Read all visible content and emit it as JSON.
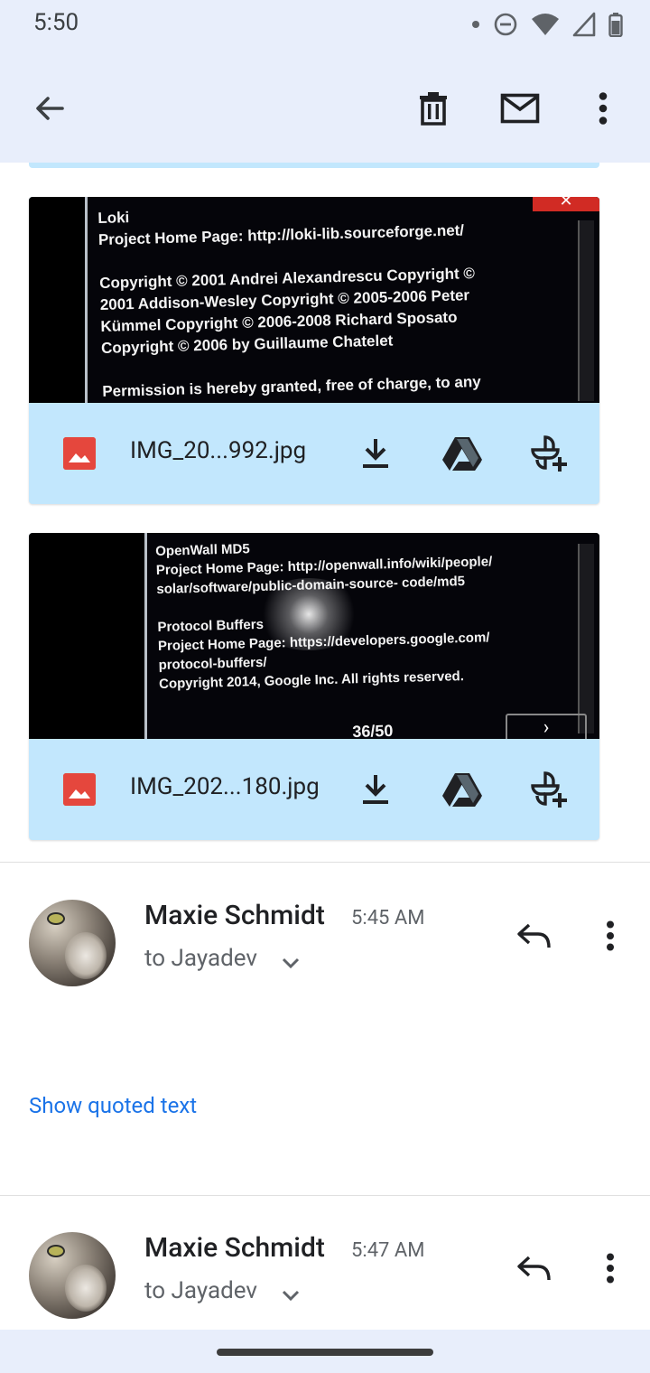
{
  "status_bar": {
    "time": "5:50",
    "icons": [
      "notification-dot-icon",
      "do-not-disturb-icon",
      "wifi-icon",
      "signal-icon",
      "battery-icon"
    ]
  },
  "toolbar": {
    "icons": [
      "back-arrow-icon",
      "delete-icon",
      "mark-unread-icon",
      "more-vert-icon"
    ]
  },
  "attachments": [
    {
      "file_name": "IMG_20...992.jpg",
      "thumbnail_text": "Loki\nProject Home Page: http://loki-lib.sourceforge.net/\n\nCopyright © 2001 Andrei Alexandrescu Copyright ©\n2001 Addison-Wesley Copyright © 2005-2006 Peter\nKümmel Copyright © 2006-2008 Richard Sposato\nCopyright © 2006 by Guillaume Chatelet\n\nPermission is hereby granted, free of charge, to any",
      "actions": [
        "download-icon",
        "drive-icon",
        "add-to-photos-icon"
      ]
    },
    {
      "file_name": "IMG_202...180.jpg",
      "thumbnail_text": "OpenWall MD5\nProject Home Page: http://openwall.info/wiki/people/\nsolar/software/public-domain-source- code/md5\n\nProtocol Buffers\nProject Home Page: https://developers.google.com/\nprotocol-buffers/\nCopyright 2014, Google Inc. All rights reserved.",
      "page_indicator": "36/50",
      "actions": [
        "download-icon",
        "drive-icon",
        "add-to-photos-icon"
      ]
    }
  ],
  "messages": [
    {
      "sender": "Maxie Schmidt",
      "time": "5:45 AM",
      "recipient": "to Jayadev",
      "quoted_link": "Show quoted text"
    },
    {
      "sender": "Maxie Schmidt",
      "time": "5:47 AM",
      "recipient": "to Jayadev"
    }
  ],
  "colors": {
    "header_bg": "#e8eefb",
    "attachment_bar": "#c2e7fd",
    "link": "#1a73e8",
    "image_icon": "#e5473d"
  }
}
